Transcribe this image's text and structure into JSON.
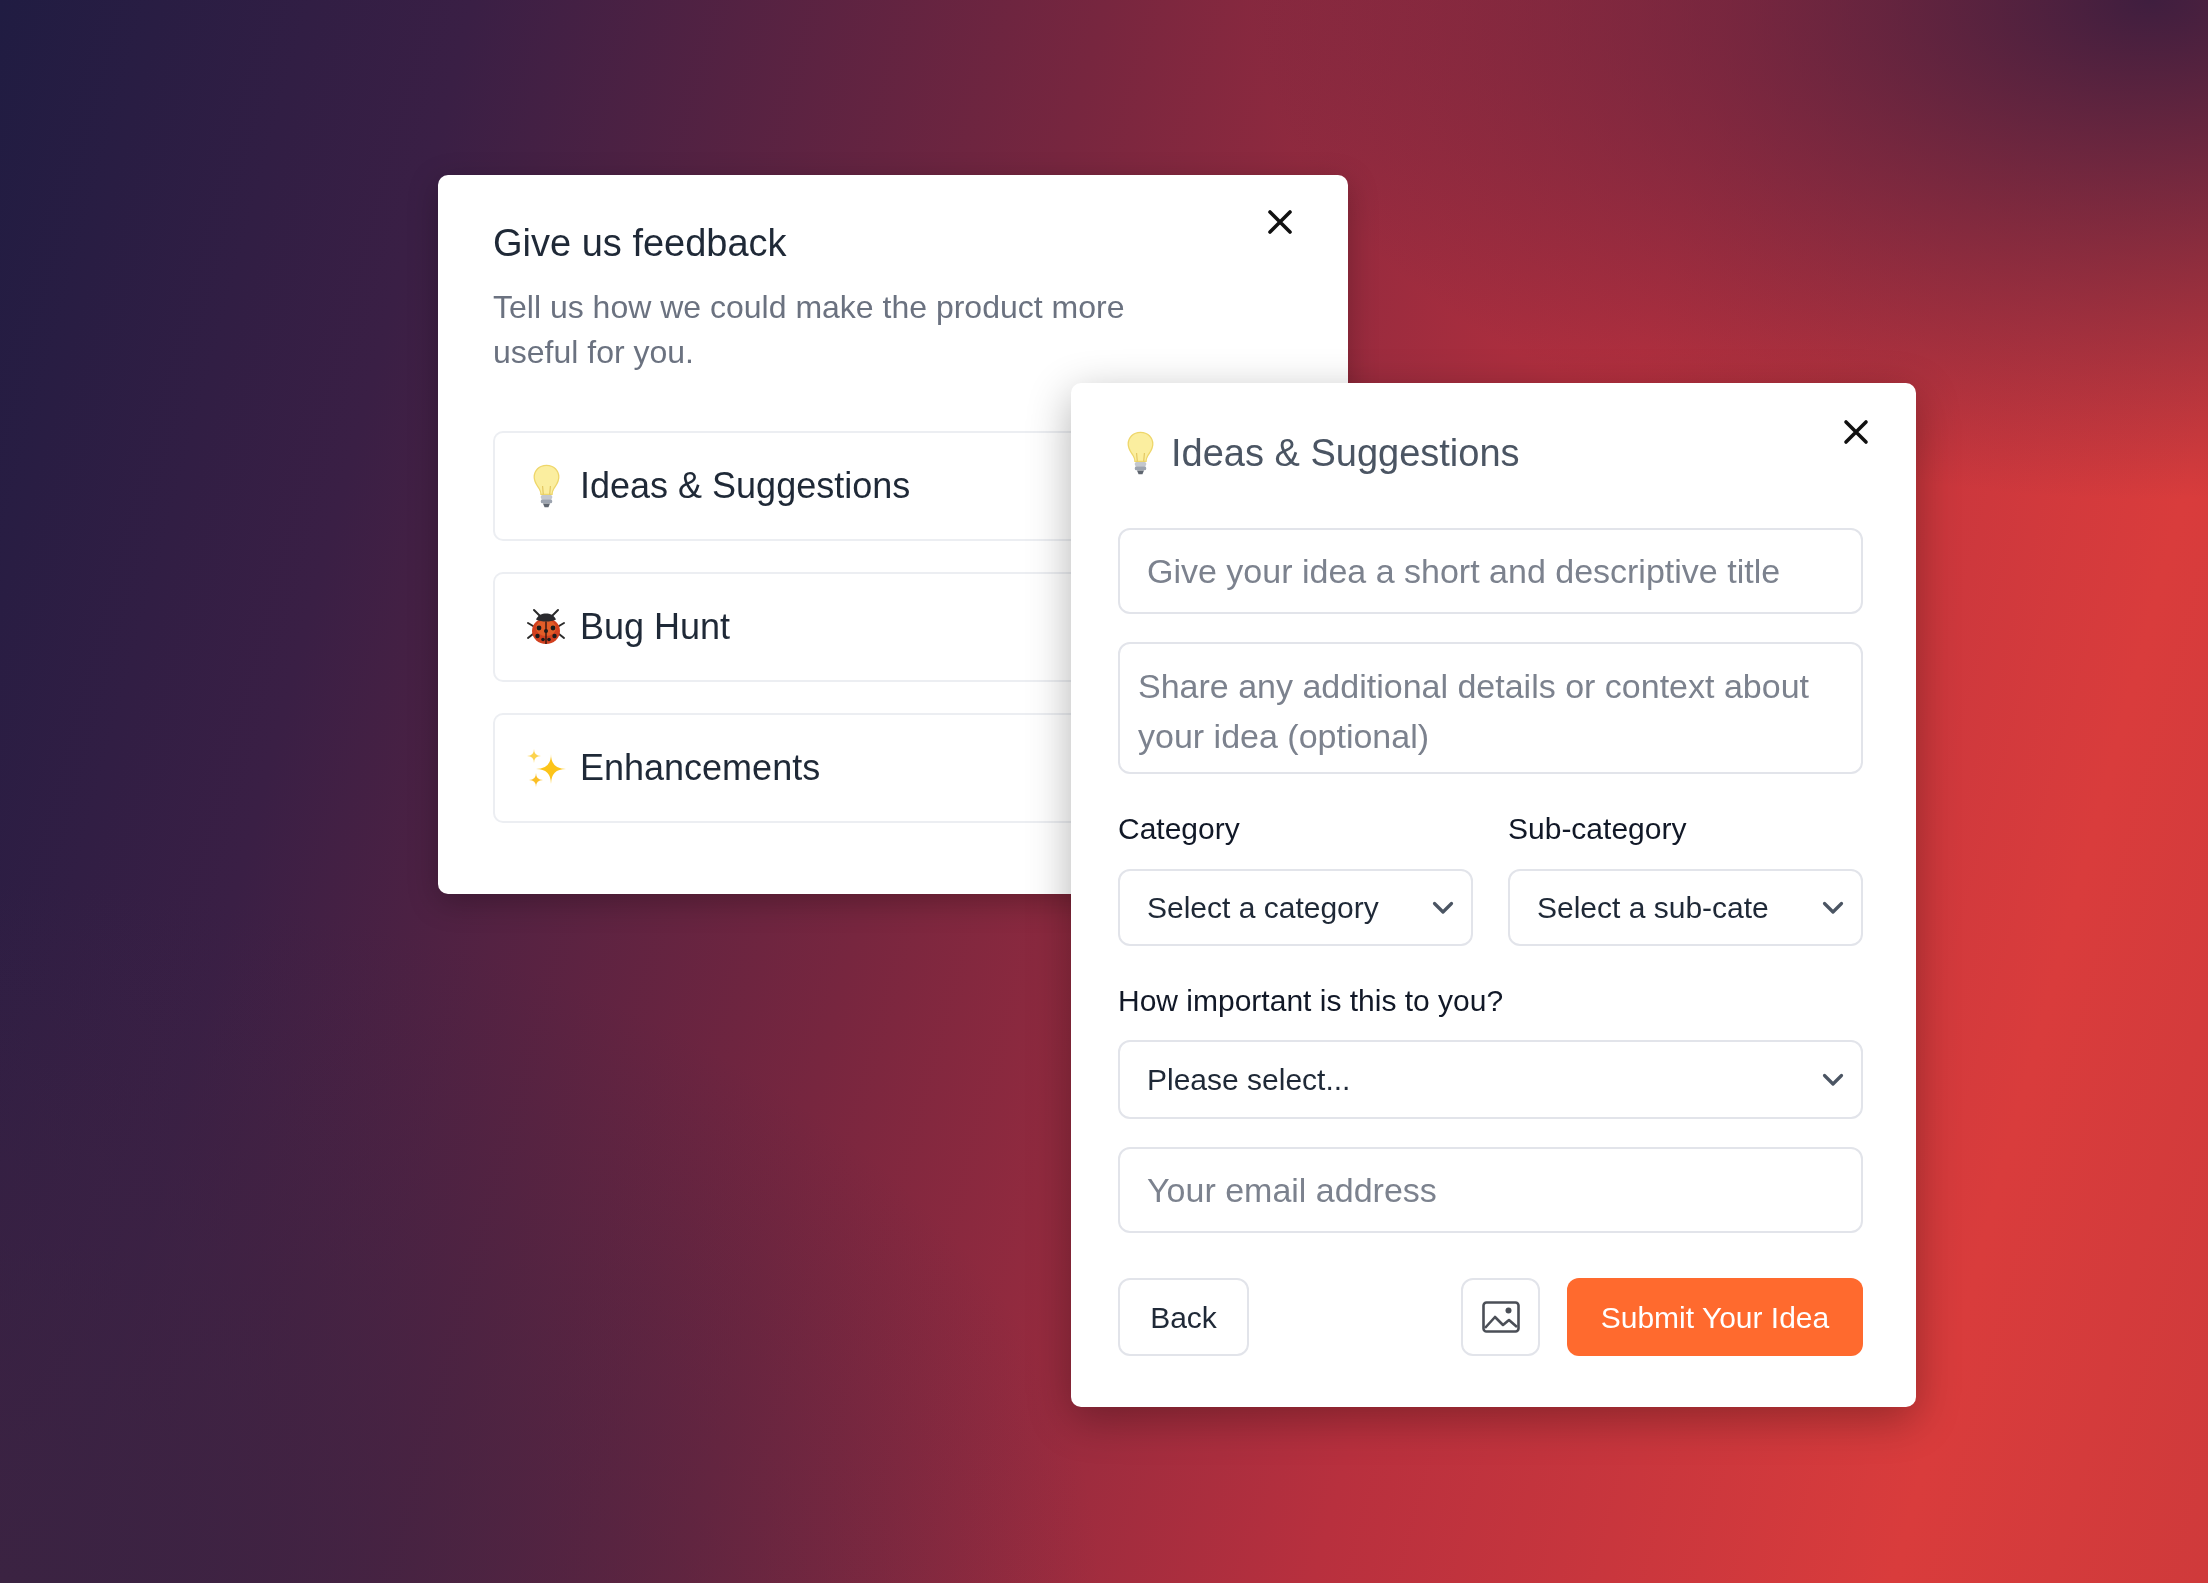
{
  "feedback_dialog": {
    "title": "Give us feedback",
    "description": "Tell us how we could make the product more useful for you.",
    "options": [
      {
        "kind": "idea",
        "label": "Ideas & Suggestions"
      },
      {
        "kind": "bug",
        "label": "Bug Hunt"
      },
      {
        "kind": "enhancement",
        "label": "Enhancements"
      }
    ]
  },
  "idea_dialog": {
    "title": "Ideas & Suggestions",
    "title_field": {
      "placeholder": "Give your idea a short and descriptive title"
    },
    "details_field": {
      "placeholder": "Share any additional details or context about your idea (optional)"
    },
    "category": {
      "label": "Category",
      "value": "Select a category"
    },
    "sub_category": {
      "label": "Sub-category",
      "value": "Select a sub-cate"
    },
    "importance": {
      "label": "How important is this to you?",
      "value": "Please select..."
    },
    "email_field": {
      "placeholder": "Your email address"
    },
    "back_button": "Back",
    "submit_button": "Submit Your Idea"
  }
}
